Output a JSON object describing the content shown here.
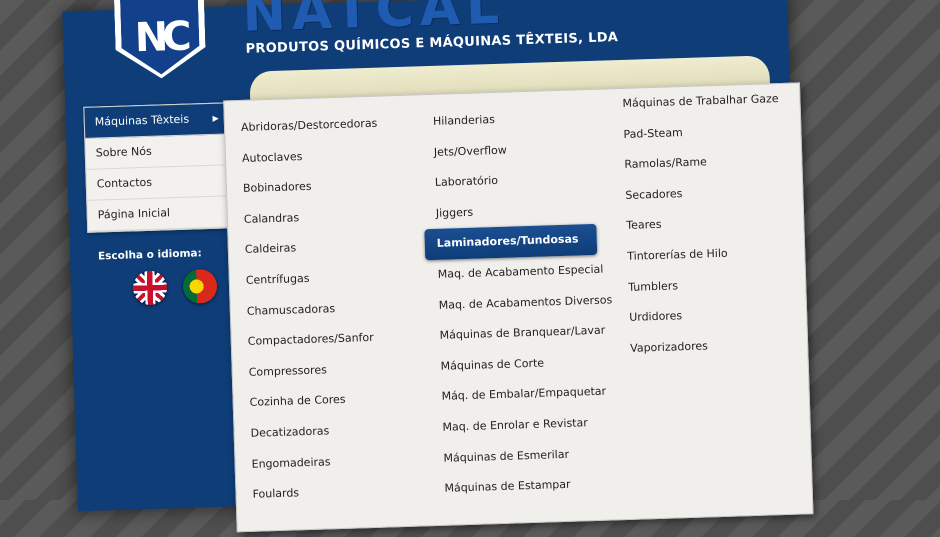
{
  "header": {
    "logo_text": "NC",
    "brand_name": "NATCAL",
    "subtitle": "PRODUTOS QUÍMICOS E MÁQUINAS TÊXTEIS, LDA"
  },
  "sidebar": {
    "items": [
      {
        "label": "Máquinas Têxteis",
        "active": true
      },
      {
        "label": "Sobre Nós"
      },
      {
        "label": "Contactos"
      },
      {
        "label": "Página Inicial"
      }
    ],
    "language_label": "Escolha o idioma:",
    "languages": [
      "English (UK flag)",
      "Português (PT flag)"
    ]
  },
  "dropdown": {
    "selected": "Laminadores/Tundosas",
    "columns": [
      [
        "Abridoras/Destorcedoras",
        "Autoclaves",
        "Bobinadores",
        "Calandras",
        "Caldeiras",
        "Centrífugas",
        "Chamuscadoras",
        "Compactadores/Sanfor",
        "Compressores",
        "Cozinha de Cores",
        "Decatizadoras",
        "Engomadeiras",
        "Foulards"
      ],
      [
        "Hilanderias",
        "Jets/Overflow",
        "Laboratório",
        "Jiggers",
        "Laminadores/Tundosas",
        "Maq. de Acabamento Especial",
        "Maq. de Acabamentos Diversos",
        "Máquinas de Branquear/Lavar",
        "Máquinas de Corte",
        "Máq. de Embalar/Empaquetar",
        "Maq. de Enrolar e Revistar",
        "Máquinas de Esmerilar",
        "Máquinas de Estampar"
      ],
      [
        "Máquinas de Trabalhar Gaze",
        "Pad-Steam",
        "Ramolas/Rame",
        "Secadores",
        "Teares",
        "Tintorerías de Hilo",
        "Tumblers",
        "Urdidores",
        "Vaporizadores"
      ]
    ]
  },
  "colors": {
    "primary_navy": "#0e3d78",
    "panel_bg": "#f0efec",
    "background_stripes": "#5a5a5a"
  }
}
